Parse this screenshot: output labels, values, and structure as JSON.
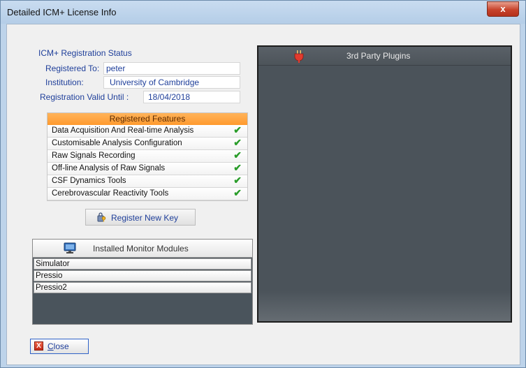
{
  "window": {
    "title": "Detailed ICM+ License Info",
    "close_glyph": "x"
  },
  "registration": {
    "title": "ICM+ Registration Status",
    "registered_to_label": "Registered To:",
    "registered_to_value": "peter",
    "institution_label": "Institution:",
    "institution_value": "University of Cambridge",
    "valid_until_label": "Registration Valid Until :",
    "valid_until_value": "18/04/2018"
  },
  "features": {
    "header": "Registered Features",
    "items": [
      {
        "label": "Data Acquisition And Real-time Analysis",
        "checked": true
      },
      {
        "label": "Customisable Analysis Configuration",
        "checked": true
      },
      {
        "label": "Raw Signals Recording",
        "checked": true
      },
      {
        "label": "Off-line Analysis of Raw Signals",
        "checked": true
      },
      {
        "label": "CSF Dynamics Tools",
        "checked": true
      },
      {
        "label": "Cerebrovascular Reactivity Tools",
        "checked": true
      }
    ],
    "check_glyph": "✔"
  },
  "register_button": {
    "label": "Register New Key",
    "icon": "key-icon"
  },
  "monitors": {
    "header": "Installed Monitor Modules",
    "icon": "monitor-icon",
    "items": [
      "Simulator",
      "Pressio",
      "Pressio2"
    ]
  },
  "plugins": {
    "header": "3rd Party Plugins",
    "icon": "plug-icon"
  },
  "close_button": {
    "accel": "C",
    "rest": "lose",
    "icon_glyph": "X"
  },
  "colors": {
    "accent_text": "#1f3f9a",
    "features_header": "#ff9a2e",
    "check": "#2a9d2a",
    "dark_panel": "#4b535a"
  }
}
